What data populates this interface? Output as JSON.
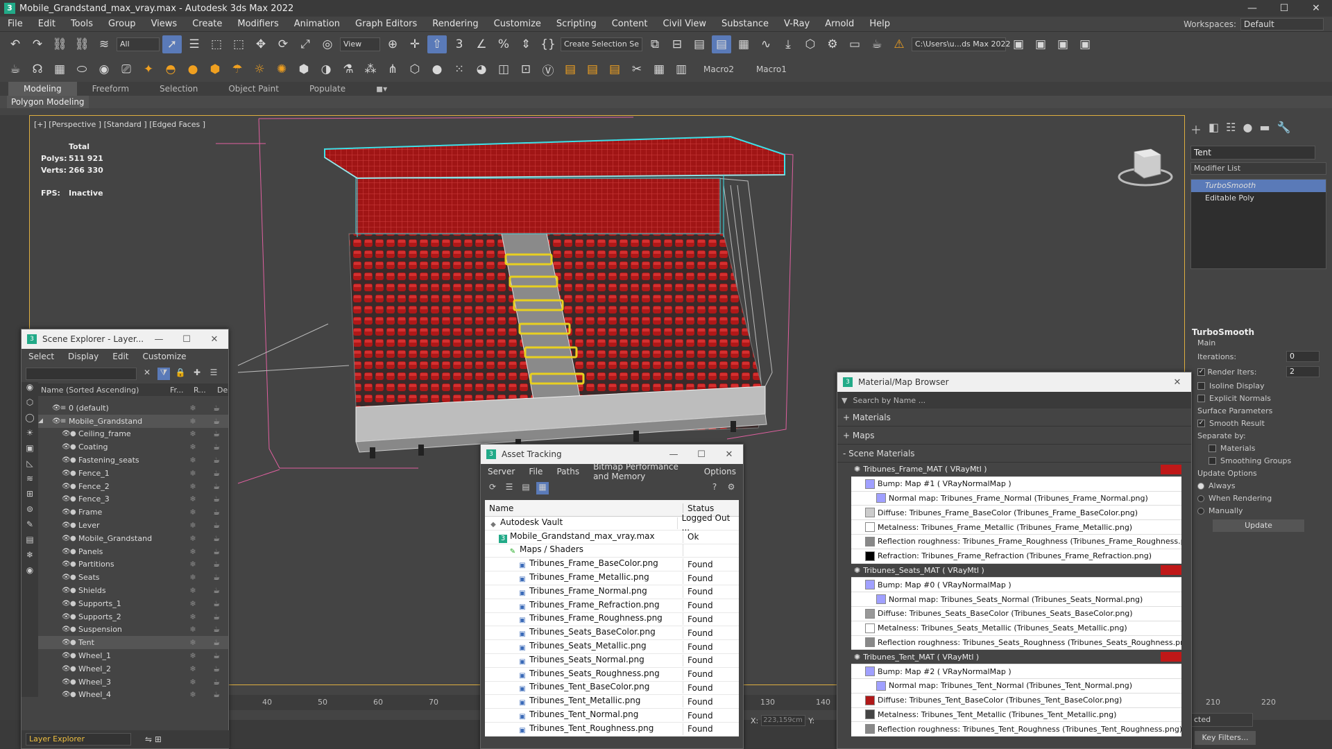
{
  "window": {
    "title": "Mobile_Grandstand_max_vray.max - Autodesk 3ds Max 2022",
    "minimize": "—",
    "maximize": "☐",
    "close": "✕"
  },
  "menu": [
    "File",
    "Edit",
    "Tools",
    "Group",
    "Views",
    "Create",
    "Modifiers",
    "Animation",
    "Graph Editors",
    "Rendering",
    "Customize",
    "Scripting",
    "Content",
    "Civil View",
    "Substance",
    "V-Ray",
    "Arnold",
    "Help"
  ],
  "workspace": {
    "label": "Workspaces:",
    "value": "Default"
  },
  "toolbar1": {
    "filter": "All",
    "view": "View",
    "selection_set": "Create Selection Se",
    "path": "C:\\Users\\u...ds Max 2022"
  },
  "toolbar2": {
    "macro2": "Macro2",
    "macro1": "Macro1"
  },
  "ribbon": {
    "tabs": [
      "Modeling",
      "Freeform",
      "Selection",
      "Object Paint",
      "Populate"
    ],
    "sub": "Polygon Modeling"
  },
  "viewport": {
    "label": "[+] [Perspective ] [Standard ] [Edged Faces ]",
    "total_label": "Total",
    "polys_label": "Polys:",
    "polys": "511 921",
    "verts_label": "Verts:",
    "verts": "266 330",
    "fps_label": "FPS:",
    "fps": "Inactive"
  },
  "command_panel": {
    "object_name": "Tent",
    "modifier_list": "Modifier List",
    "stack": [
      "TurboSmooth",
      "Editable Poly"
    ],
    "rollout": "TurboSmooth",
    "main": "Main",
    "iterations_label": "Iterations:",
    "iterations": "0",
    "render_iters_label": "Render Iters:",
    "render_iters": "2",
    "isoline": "Isoline Display",
    "explicit": "Explicit Normals",
    "surface": "Surface Parameters",
    "smooth_result": "Smooth Result",
    "separate": "Separate by:",
    "materials": "Materials",
    "smoothing_groups": "Smoothing Groups",
    "update_options": "Update Options",
    "always": "Always",
    "when_rendering": "When Rendering",
    "manually": "Manually",
    "update": "Update"
  },
  "scene_explorer": {
    "title": "Scene Explorer - Layer...",
    "menu": [
      "Select",
      "Display",
      "Edit",
      "Customize"
    ],
    "col_name": "Name (Sorted Ascending)",
    "col_fr": "Fr...",
    "col_r": "R...",
    "col_de": "De",
    "rows": [
      {
        "name": "0 (default)",
        "level": 1
      },
      {
        "name": "Mobile_Grandstand",
        "level": 1
      },
      {
        "name": "Ceiling_frame",
        "level": 2
      },
      {
        "name": "Coating",
        "level": 2
      },
      {
        "name": "Fastening_seats",
        "level": 2
      },
      {
        "name": "Fence_1",
        "level": 2
      },
      {
        "name": "Fence_2",
        "level": 2
      },
      {
        "name": "Fence_3",
        "level": 2
      },
      {
        "name": "Frame",
        "level": 2
      },
      {
        "name": "Lever",
        "level": 2
      },
      {
        "name": "Mobile_Grandstand",
        "level": 2
      },
      {
        "name": "Panels",
        "level": 2
      },
      {
        "name": "Partitions",
        "level": 2
      },
      {
        "name": "Seats",
        "level": 2
      },
      {
        "name": "Shields",
        "level": 2
      },
      {
        "name": "Supports_1",
        "level": 2
      },
      {
        "name": "Supports_2",
        "level": 2
      },
      {
        "name": "Suspension",
        "level": 2
      },
      {
        "name": "Tent",
        "level": 2
      },
      {
        "name": "Wheel_1",
        "level": 2
      },
      {
        "name": "Wheel_2",
        "level": 2
      },
      {
        "name": "Wheel_3",
        "level": 2
      },
      {
        "name": "Wheel_4",
        "level": 2
      }
    ],
    "bottom": "Layer Explorer"
  },
  "asset_tracking": {
    "title": "Asset Tracking",
    "menu": [
      "Server",
      "File",
      "Paths",
      "Bitmap Performance and Memory",
      "Options"
    ],
    "col_name": "Name",
    "col_status": "Status",
    "rows": [
      {
        "name": "Autodesk Vault",
        "status": "Logged Out ...",
        "indent": 1
      },
      {
        "name": "Mobile_Grandstand_max_vray.max",
        "status": "Ok",
        "indent": 2
      },
      {
        "name": "Maps / Shaders",
        "status": "",
        "indent": 3
      },
      {
        "name": "Tribunes_Frame_BaseColor.png",
        "status": "Found",
        "indent": 4
      },
      {
        "name": "Tribunes_Frame_Metallic.png",
        "status": "Found",
        "indent": 4
      },
      {
        "name": "Tribunes_Frame_Normal.png",
        "status": "Found",
        "indent": 4
      },
      {
        "name": "Tribunes_Frame_Refraction.png",
        "status": "Found",
        "indent": 4
      },
      {
        "name": "Tribunes_Frame_Roughness.png",
        "status": "Found",
        "indent": 4
      },
      {
        "name": "Tribunes_Seats_BaseColor.png",
        "status": "Found",
        "indent": 4
      },
      {
        "name": "Tribunes_Seats_Metallic.png",
        "status": "Found",
        "indent": 4
      },
      {
        "name": "Tribunes_Seats_Normal.png",
        "status": "Found",
        "indent": 4
      },
      {
        "name": "Tribunes_Seats_Roughness.png",
        "status": "Found",
        "indent": 4
      },
      {
        "name": "Tribunes_Tent_BaseColor.png",
        "status": "Found",
        "indent": 4
      },
      {
        "name": "Tribunes_Tent_Metallic.png",
        "status": "Found",
        "indent": 4
      },
      {
        "name": "Tribunes_Tent_Normal.png",
        "status": "Found",
        "indent": 4
      },
      {
        "name": "Tribunes_Tent_Roughness.png",
        "status": "Found",
        "indent": 4
      }
    ]
  },
  "material_browser": {
    "title": "Material/Map Browser",
    "search": "Search by Name ...",
    "groups": [
      "+ Materials",
      "+ Maps",
      "- Scene Materials"
    ],
    "rows": [
      {
        "text": "Tribunes_Frame_MAT  ( VRayMtl )",
        "type": "head",
        "swatch": ""
      },
      {
        "text": "Bump: Map #1  ( VRayNormalMap )",
        "indent": 1,
        "swatch": "#a0a0ff"
      },
      {
        "text": "Normal map: Tribunes_Frame_Normal (Tribunes_Frame_Normal.png)",
        "indent": 2,
        "swatch": "#a0a0ff"
      },
      {
        "text": "Diffuse: Tribunes_Frame_BaseColor (Tribunes_Frame_BaseColor.png)",
        "indent": 1,
        "swatch": "#cccccc"
      },
      {
        "text": "Metalness: Tribunes_Frame_Metallic (Tribunes_Frame_Metallic.png)",
        "indent": 1,
        "swatch": "#ffffff"
      },
      {
        "text": "Reflection roughness: Tribunes_Frame_Roughness (Tribunes_Frame_Roughness.png)",
        "indent": 1,
        "swatch": "#888888"
      },
      {
        "text": "Refraction: Tribunes_Frame_Refraction (Tribunes_Frame_Refraction.png)",
        "indent": 1,
        "swatch": "#000000"
      },
      {
        "text": "Tribunes_Seats_MAT  ( VRayMtl )",
        "type": "head",
        "swatch": ""
      },
      {
        "text": "Bump: Map #0  ( VRayNormalMap )",
        "indent": 1,
        "swatch": "#a0a0ff"
      },
      {
        "text": "Normal map: Tribunes_Seats_Normal (Tribunes_Seats_Normal.png)",
        "indent": 2,
        "swatch": "#a0a0ff"
      },
      {
        "text": "Diffuse: Tribunes_Seats_BaseColor (Tribunes_Seats_BaseColor.png)",
        "indent": 1,
        "swatch": "#999999"
      },
      {
        "text": "Metalness: Tribunes_Seats_Metallic (Tribunes_Seats_Metallic.png)",
        "indent": 1,
        "swatch": "#ffffff"
      },
      {
        "text": "Reflection roughness: Tribunes_Seats_Roughness (Tribunes_Seats_Roughness.png)",
        "indent": 1,
        "swatch": "#888888"
      },
      {
        "text": "Tribunes_Tent_MAT  ( VRayMtl )",
        "type": "head",
        "swatch": ""
      },
      {
        "text": "Bump: Map #2  ( VRayNormalMap )",
        "indent": 1,
        "swatch": "#a0a0ff"
      },
      {
        "text": "Normal map: Tribunes_Tent_Normal (Tribunes_Tent_Normal.png)",
        "indent": 2,
        "swatch": "#a0a0ff"
      },
      {
        "text": "Diffuse: Tribunes_Tent_BaseColor (Tribunes_Tent_BaseColor.png)",
        "indent": 1,
        "swatch": "#b01818"
      },
      {
        "text": "Metalness: Tribunes_Tent_Metallic (Tribunes_Tent_Metallic.png)",
        "indent": 1,
        "swatch": "#444444"
      },
      {
        "text": "Reflection roughness: Tribunes_Tent_Roughness (Tribunes_Tent_Roughness.png)",
        "indent": 1,
        "swatch": "#888888"
      }
    ]
  },
  "timeline": {
    "ticks": [
      "40",
      "50",
      "60",
      "70",
      "130",
      "140",
      "210",
      "220"
    ]
  },
  "status": {
    "x_label": "X:",
    "x_value": "223,159cm",
    "y_label": "Y:",
    "key_filters": "Key Filters...",
    "selected": "cted"
  },
  "colors": {
    "accent": "#5a7ab8",
    "tent_red": "#b01818",
    "viewport_border": "#e0b040",
    "selection": "#3ee0e8",
    "bounds": "#e060a0"
  }
}
